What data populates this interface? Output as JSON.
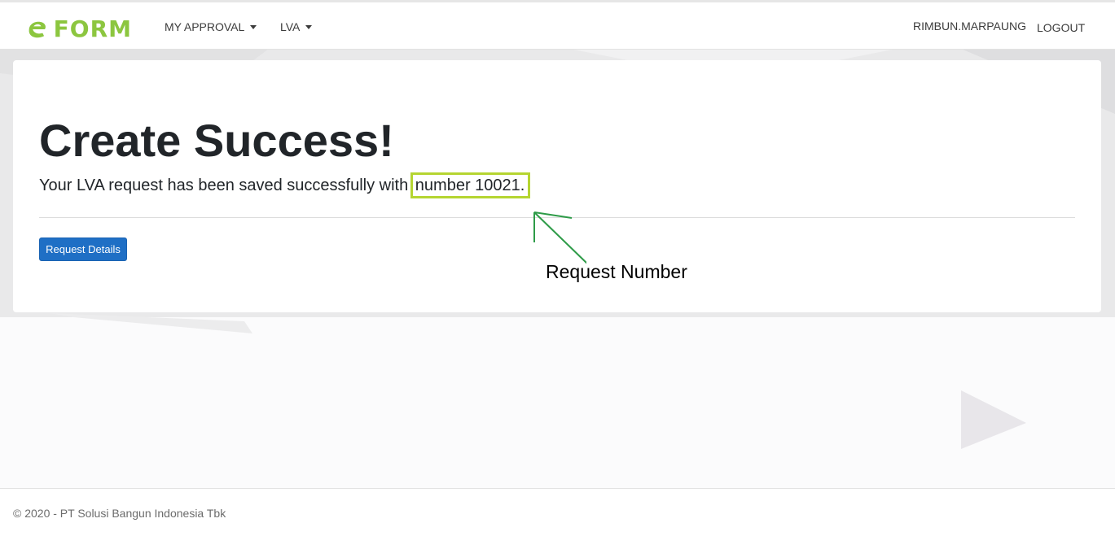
{
  "navbar": {
    "logo_text": "FORM",
    "menu": [
      {
        "label": "MY APPROVAL"
      },
      {
        "label": "LVA"
      }
    ],
    "username": "RIMBUN.MARPAUNG",
    "logout_label": "LOGOUT"
  },
  "main": {
    "title": "Create Success!",
    "message_prefix": "Your LVA request has been saved successfully with ",
    "message_number": "number 10021.",
    "request_details_label": "Request Details"
  },
  "annotation": {
    "label": "Request Number"
  },
  "footer": {
    "text": "© 2020 - PT Solusi Bangun Indonesia Tbk"
  },
  "colors": {
    "brand_green": "#8cc63f",
    "primary_button": "#1f6fc5",
    "highlight_box": "#b5d531",
    "annotation_arrow": "#2e9b48"
  }
}
